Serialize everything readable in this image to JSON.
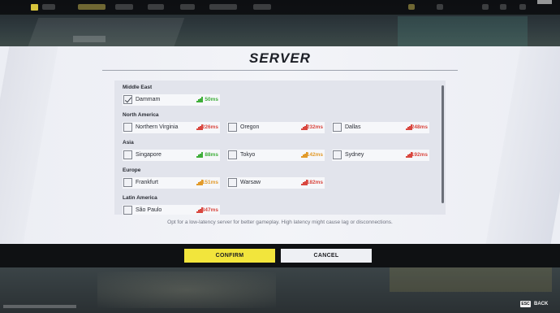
{
  "title": "SERVER",
  "hint": "Opt for a low-latency server for better gameplay. High latency might cause lag or disconnections.",
  "buttons": {
    "confirm": "CONFIRM",
    "cancel": "CANCEL"
  },
  "footer": {
    "esc_key": "ESC",
    "back_label": "BACK"
  },
  "colors": {
    "good": "#3fae3a",
    "medium": "#e29a2a",
    "bad": "#d9473f",
    "accent": "#f2e53c"
  },
  "regions": [
    {
      "name": "Middle East",
      "servers": [
        {
          "name": "Dammam",
          "ping": "50ms",
          "quality": "good",
          "checked": true
        }
      ]
    },
    {
      "name": "North America",
      "servers": [
        {
          "name": "Northern Virginia",
          "ping": "226ms",
          "quality": "bad",
          "checked": false
        },
        {
          "name": "Oregon",
          "ping": "232ms",
          "quality": "bad",
          "checked": false
        },
        {
          "name": "Dallas",
          "ping": "248ms",
          "quality": "bad",
          "checked": false
        }
      ]
    },
    {
      "name": "Asia",
      "servers": [
        {
          "name": "Singapore",
          "ping": "88ms",
          "quality": "good",
          "checked": false
        },
        {
          "name": "Tokyo",
          "ping": "142ms",
          "quality": "medium",
          "checked": false
        },
        {
          "name": "Sydney",
          "ping": "192ms",
          "quality": "bad",
          "checked": false
        }
      ]
    },
    {
      "name": "Europe",
      "servers": [
        {
          "name": "Frankfurt",
          "ping": "151ms",
          "quality": "medium",
          "checked": false
        },
        {
          "name": "Warsaw",
          "ping": "182ms",
          "quality": "bad",
          "checked": false
        }
      ]
    },
    {
      "name": "Latin America",
      "servers": [
        {
          "name": "São Paulo",
          "ping": "347ms",
          "quality": "bad",
          "checked": false
        }
      ]
    }
  ]
}
